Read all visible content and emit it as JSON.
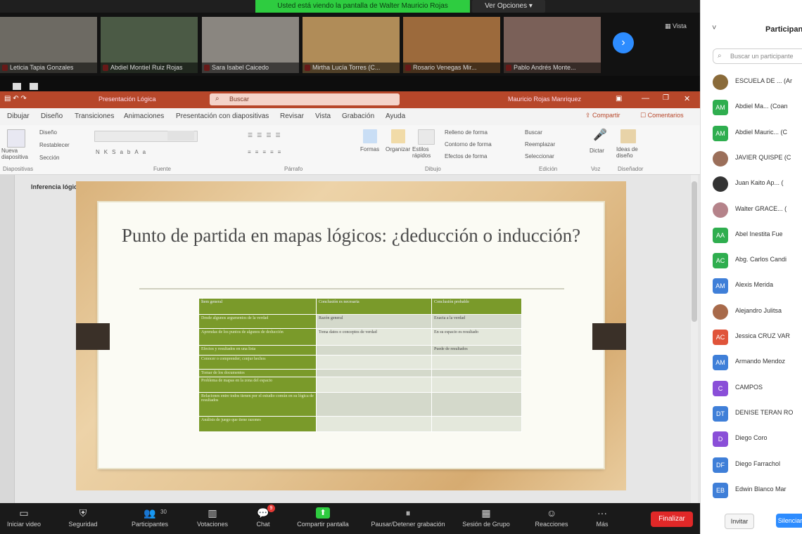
{
  "zoom": {
    "share_banner": "Usted está viendo la pantalla de Walter Mauricio Rojas",
    "view_options": "Ver Opciones",
    "view_label": "Vista",
    "next_page": "›",
    "video_tiles": [
      {
        "name": "Leticia Tapia Gonzales",
        "bg": "#6d6a63"
      },
      {
        "name": "Abdiel Montiel Ruiz Rojas",
        "bg": "#4b5a45"
      },
      {
        "name": "Sara Isabel Caicedo",
        "bg": "#8a8680"
      },
      {
        "name": "Mirtha Lucía Torres (C...",
        "bg": "#b08c58"
      },
      {
        "name": "Rosario Venegas Mir...",
        "bg": "#9c6a3c"
      },
      {
        "name": "Pablo Andrés Monte...",
        "bg": "#7a6058"
      }
    ],
    "toolbar": [
      {
        "label": "Iniciar video",
        "icon": "▭"
      },
      {
        "label": "Seguridad",
        "icon": "⛨"
      },
      {
        "label": "Participantes",
        "icon": "👥"
      },
      {
        "label": "Votaciones",
        "icon": "▥"
      },
      {
        "label": "Chat",
        "icon": "💬"
      },
      {
        "label": "Compartir pantalla",
        "icon": "⬆"
      },
      {
        "label": "Pausar/Detener grabación",
        "icon": "⏸"
      },
      {
        "label": "Sesión de Grupo",
        "icon": "▦"
      },
      {
        "label": "Reacciones",
        "icon": "☺"
      },
      {
        "label": "Más",
        "icon": "···"
      }
    ],
    "participants_count": "30",
    "chat_badge": "9",
    "end_button": "Finalizar",
    "colors": {
      "share_green": "#2ecc40",
      "accent_blue": "#2d8cff",
      "end_red": "#e02828"
    }
  },
  "powerpoint": {
    "doc_name": "Presentación Lógica",
    "search_placeholder": "Buscar",
    "user_name": "Mauricio Rojas Manriquez",
    "tabs": [
      "Dibujar",
      "Diseño",
      "Transiciones",
      "Animaciones",
      "Presentación con diapositivas",
      "Revisar",
      "Vista",
      "Grabación",
      "Ayuda"
    ],
    "share": "Compartir",
    "comments": "Comentarios",
    "ribbon_groups": [
      "Diapositivas",
      "Fuente",
      "Párrafo",
      "Dibujo",
      "Edición",
      "Voz",
      "Diseñador"
    ],
    "ribbon_labels": {
      "new_slide": "Nueva diapositiva",
      "layout": "Diseño",
      "reset": "Restablecer",
      "section": "Sección",
      "shapes": "Formas",
      "arrange": "Organizar",
      "quick_styles": "Estilos rápidos",
      "shape_fill": "Relleno de forma",
      "shape_outline": "Contorno de forma",
      "shape_effects": "Efectos de forma",
      "find": "Buscar",
      "replace": "Reemplazar",
      "select": "Seleccionar",
      "dictate": "Dictar",
      "design_ideas": "Ideas de diseño"
    },
    "slide_label": "Inferencia lógica",
    "slide_title": "Punto de partida en mapas lógicos: ¿deducción o inducción?",
    "table": {
      "headers": [
        "Ítem general",
        "Conclusión es necesaria",
        "Conclusión probable"
      ],
      "rows": [
        [
          "Desde algunos argumentos de la verdad",
          "Razón general",
          "Exacta a la verdad"
        ],
        [
          "Aprendas de los puntos de algunos de deducción",
          "Toma datos o conceptos de verdad",
          "En su espacio es resultado"
        ],
        [
          "Efectos y resultados en una lista",
          "",
          "Puede de resultados"
        ],
        [
          "Conocer o comprender; conjur hechos",
          "",
          ""
        ],
        [
          "Tomar de los documentos",
          "",
          ""
        ],
        [
          "Problema de mapas en la zona del espacio",
          "",
          ""
        ],
        [
          "Relaciones entre todos tienen por el estudio común en su lógica de resultados",
          "",
          ""
        ],
        [
          "Análisis de juego que tiene razones",
          "",
          ""
        ]
      ]
    }
  },
  "participants_panel": {
    "title": "Participantes",
    "collapse": "˅",
    "search_placeholder": "Buscar un participante",
    "participants": [
      {
        "name": "ESCUELA DE ... (Ar",
        "initials": "",
        "color": "#8a6b3a"
      },
      {
        "name": "Abdiel Ma... (Coan",
        "initials": "AM",
        "color": "#2fae4f"
      },
      {
        "name": "Abdiel Mauric... (C",
        "initials": "AM",
        "color": "#2fae4f"
      },
      {
        "name": "JAVIER QUISPE (C",
        "initials": "",
        "color": "#9b6f5a"
      },
      {
        "name": "Juan Kaito Ap... (",
        "initials": "",
        "color": "#333333"
      },
      {
        "name": "Walter GRACE... (",
        "initials": "",
        "color": "#b5838a"
      },
      {
        "name": "Abel Inestita Fue",
        "initials": "AA",
        "color": "#2fae4f"
      },
      {
        "name": "Abg. Carlos Candi",
        "initials": "AC",
        "color": "#2fae4f"
      },
      {
        "name": "Alexis Merida",
        "initials": "AM",
        "color": "#3f7fd8"
      },
      {
        "name": "Alejandro Julitsa",
        "initials": "",
        "color": "#a86a4a"
      },
      {
        "name": "Jessica CRUZ VAR",
        "initials": "AC",
        "color": "#e0543a"
      },
      {
        "name": "Armando Mendoz",
        "initials": "AM",
        "color": "#3f7fd8"
      },
      {
        "name": "CAMPOS",
        "initials": "C",
        "color": "#8a4fd8"
      },
      {
        "name": "DENISE TERAN RO",
        "initials": "DT",
        "color": "#3f7fd8"
      },
      {
        "name": "Diego Coro",
        "initials": "D",
        "color": "#8a4fd8"
      },
      {
        "name": "Diego Farrachol",
        "initials": "DF",
        "color": "#3f7fd8"
      },
      {
        "name": "Edwin Blanco Mar",
        "initials": "EB",
        "color": "#3f7fd8"
      }
    ],
    "invite": "Invitar",
    "mute_all": "Silenciar"
  }
}
